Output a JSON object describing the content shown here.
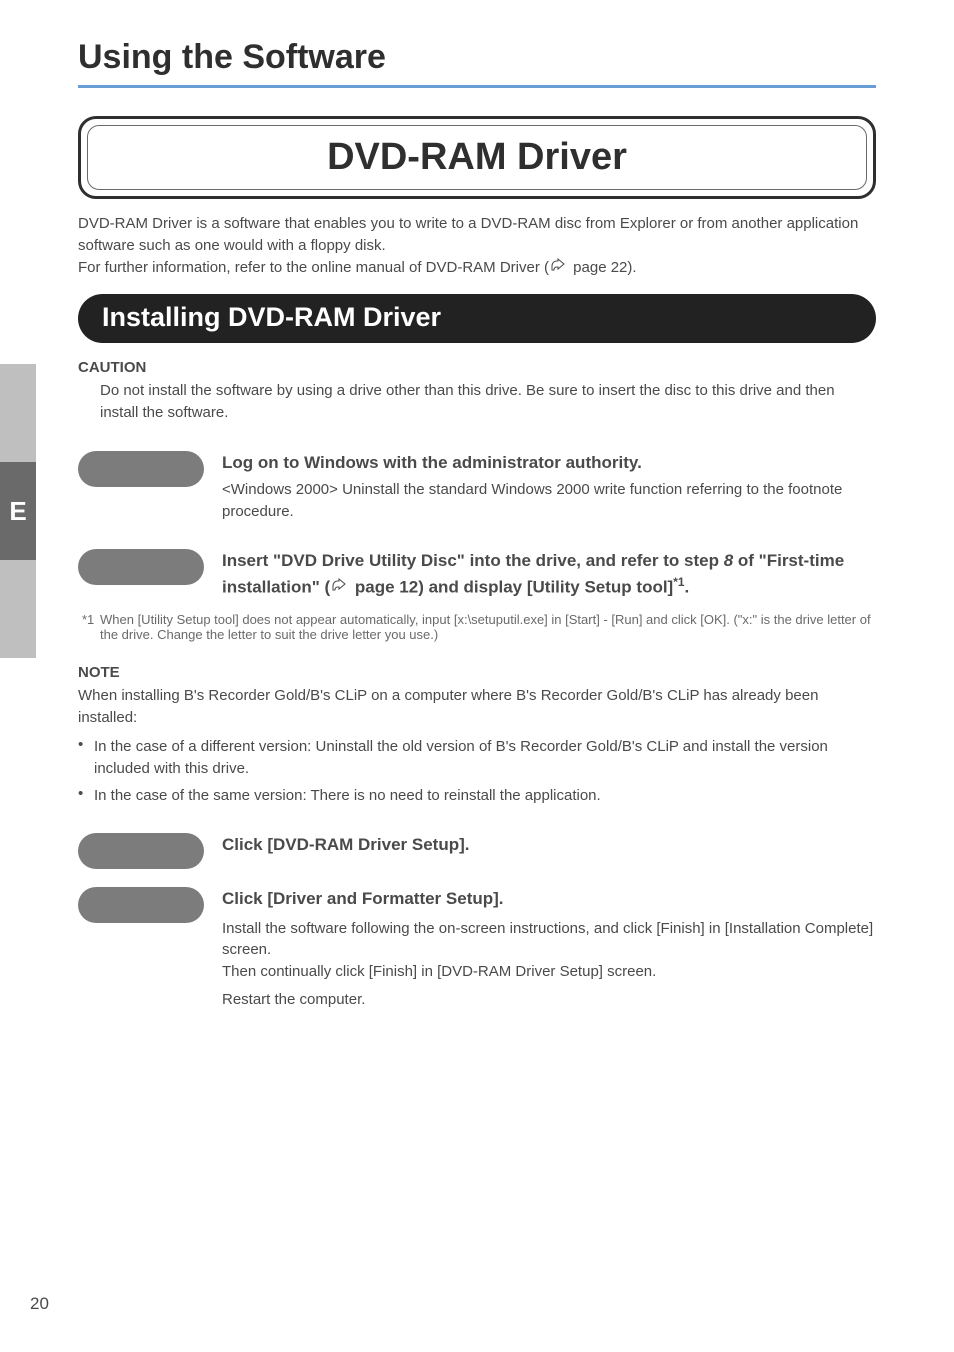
{
  "page_number": "20",
  "h1": "Using the Software",
  "title": "DVD-RAM Driver",
  "intro_1": "DVD-RAM Driver is a software that enables you to write to ",
  "intro_2": "a DVD-RAM disc",
  "intro_3": " from Explorer or from another application software such as one would with a floppy disk.",
  "intro_4": "For further information, refer to the online manual of DVD-RAM Driver (",
  "intro_5": " page 22).",
  "section_heading": "Installing DVD-RAM Driver",
  "caution_title": "CAUTION",
  "caution_body": "Do not install the software by using a drive other than this drive. Be sure to insert the disc to this drive and then install the software.",
  "step1": {
    "line1": "Log on to Windows with the administrator authority.",
    "note": "<Windows 2000> Uninstall the standard Windows 2000 write function referring to the footnote procedure."
  },
  "step2": {
    "line1_a": "Insert \"DVD Drive Utility Disc\" into the drive, and refer to step ",
    "line1_b": "8",
    "line1_c": " of \"First-time installation\" (",
    "line1_d": " page 12) and display [Utility Setup tool]",
    "line1_e": "*1",
    "line1_f": "."
  },
  "footnote": {
    "mark": "*1",
    "text": "When [Utility Setup tool] does not appear automatically, input [x:\\setuputil.exe] in [Start] - [Run] and click [OK]. (\"x:\" is the drive letter of the drive. Change the letter to suit the drive letter you use.)"
  },
  "note_head": "NOTE",
  "note_body": "When installing B's Recorder Gold/B's CLiP on a computer where B's Recorder Gold/B's CLiP has already been installed:",
  "bullet1": "In the case of a different version: Uninstall the old version of B's Recorder Gold/B's CLiP and install the version included with this drive.",
  "bullet2": "In the case of the same version: There is no need to reinstall the application.",
  "step3": "Click [DVD-RAM Driver Setup].",
  "step4": {
    "line1": "Click [Driver and Formatter Setup].",
    "line2": "Install the software following the on-screen instructions, and click [Finish] in [Installation Complete] screen.",
    "line3": "Then continually click [Finish] in [DVD-RAM Driver Setup] screen.",
    "line4": "Restart the computer."
  },
  "side_tab_label": "E"
}
